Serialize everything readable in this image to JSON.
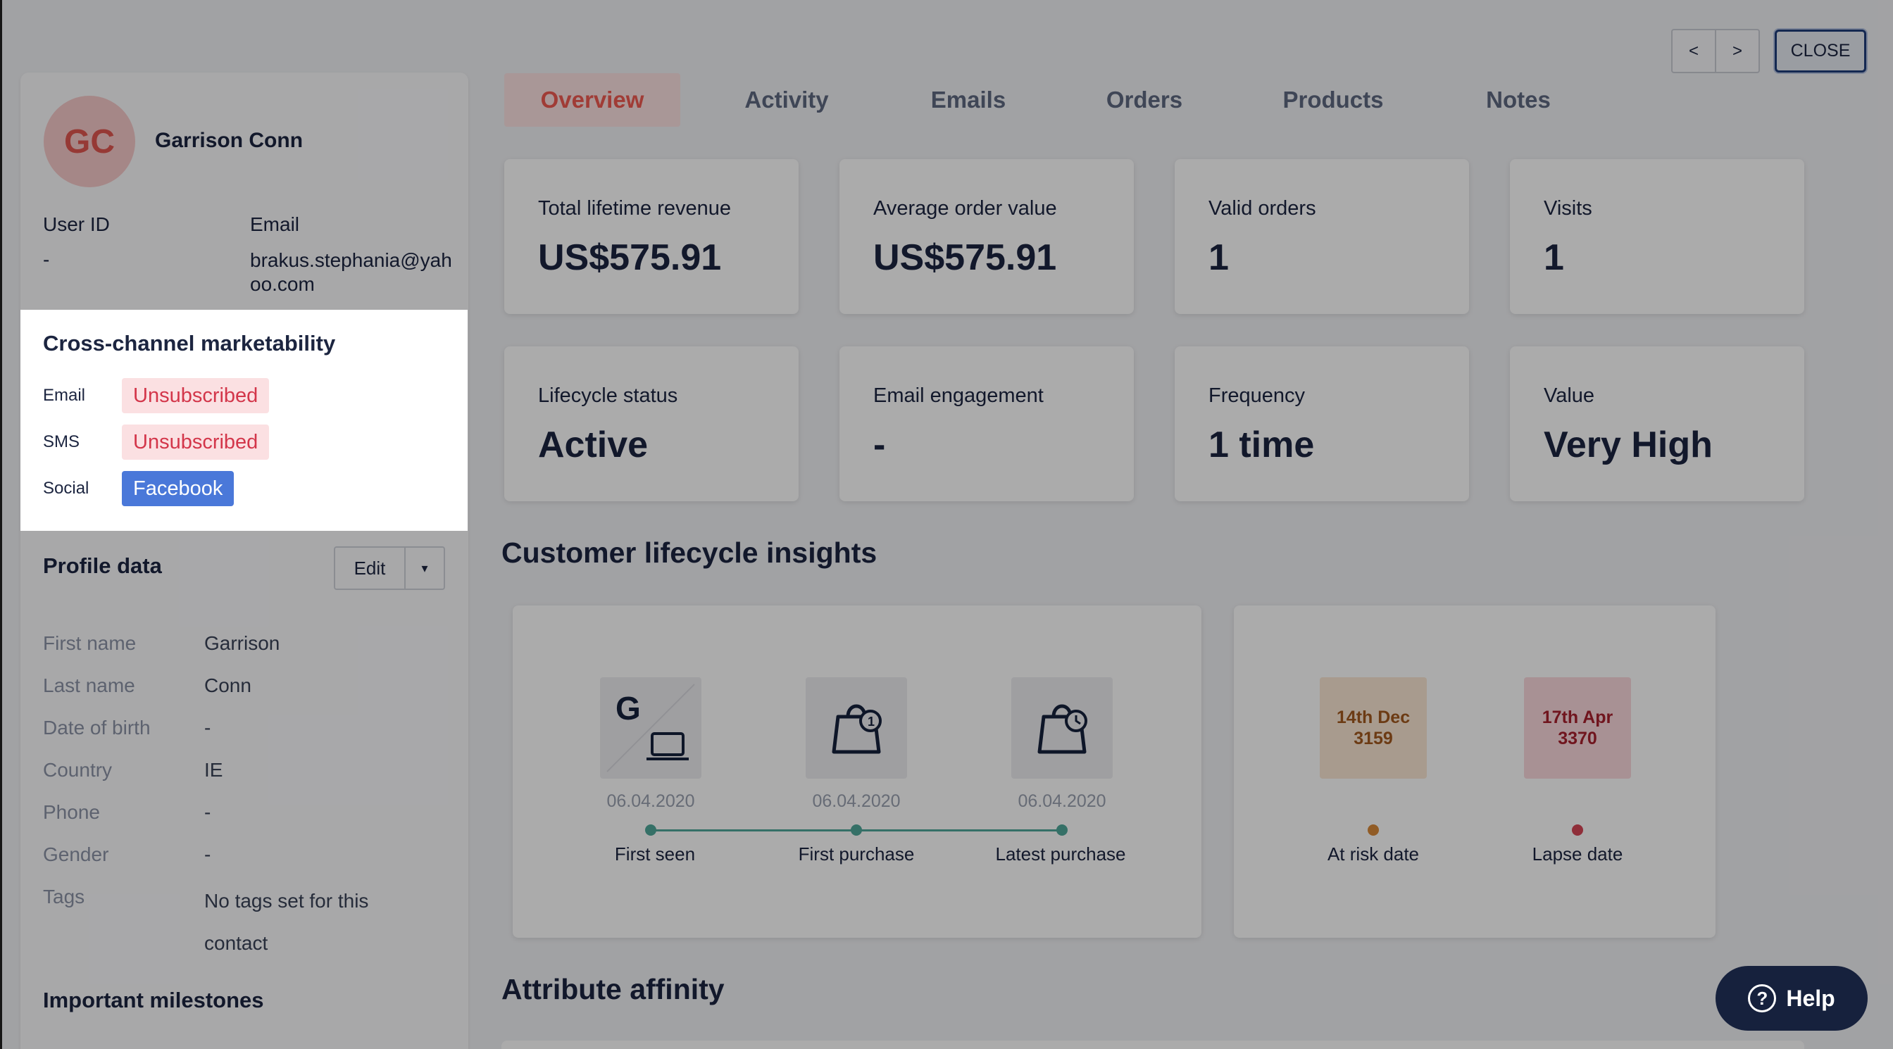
{
  "profile": {
    "initials": "GC",
    "name": "Garrison Conn",
    "user_id_label": "User ID",
    "user_id_value": "-",
    "email_label": "Email",
    "email_value": "brakus.stephania@yahoo.com"
  },
  "marketability": {
    "title": "Cross-channel marketability",
    "email_label": "Email",
    "email_status": "Unsubscribed",
    "sms_label": "SMS",
    "sms_status": "Unsubscribed",
    "social_label": "Social",
    "social_status": "Facebook"
  },
  "profile_data": {
    "title": "Profile data",
    "edit_label": "Edit",
    "fields": [
      {
        "label": "First name",
        "value": "Garrison"
      },
      {
        "label": "Last name",
        "value": "Conn"
      },
      {
        "label": "Date of birth",
        "value": "-"
      },
      {
        "label": "Country",
        "value": "IE"
      },
      {
        "label": "Phone",
        "value": "-"
      },
      {
        "label": "Gender",
        "value": "-"
      },
      {
        "label": "Tags",
        "value": "No tags set for this contact"
      }
    ]
  },
  "milestones_title": "Important milestones",
  "nav": {
    "prev": "<",
    "next": ">",
    "close": "CLOSE"
  },
  "tabs": [
    {
      "label": "Overview",
      "active": true
    },
    {
      "label": "Activity"
    },
    {
      "label": "Emails"
    },
    {
      "label": "Orders"
    },
    {
      "label": "Products"
    },
    {
      "label": "Notes"
    }
  ],
  "stats": [
    {
      "label": "Total lifetime revenue",
      "value": "US$575.91"
    },
    {
      "label": "Average order value",
      "value": "US$575.91"
    },
    {
      "label": "Valid orders",
      "value": "1"
    },
    {
      "label": "Visits",
      "value": "1"
    },
    {
      "label": "Lifecycle status",
      "value": "Active"
    },
    {
      "label": "Email engagement",
      "value": "-"
    },
    {
      "label": "Frequency",
      "value": "1 time"
    },
    {
      "label": "Value",
      "value": "Very High"
    }
  ],
  "lifecycle": {
    "title": "Customer lifecycle insights",
    "timeline": [
      {
        "date": "06.04.2020",
        "label": "First seen",
        "icon": "google-laptop-icon"
      },
      {
        "date": "06.04.2020",
        "label": "First purchase",
        "icon": "shopping-bag-icon"
      },
      {
        "date": "06.04.2020",
        "label": "Latest purchase",
        "icon": "shopping-bag-clock-icon"
      }
    ],
    "risk": [
      {
        "date": "14th Dec 3159",
        "label": "At risk date",
        "color": "#d98a3a"
      },
      {
        "date": "17th Apr 3370",
        "label": "Lapse date",
        "color": "#d64555"
      }
    ]
  },
  "affinity_title": "Attribute affinity",
  "help_label": "Help",
  "colors": {
    "accent": "#ef5a51",
    "timeline": "#4fa89a",
    "facebook": "#4a78d9",
    "navy": "#16213d"
  }
}
